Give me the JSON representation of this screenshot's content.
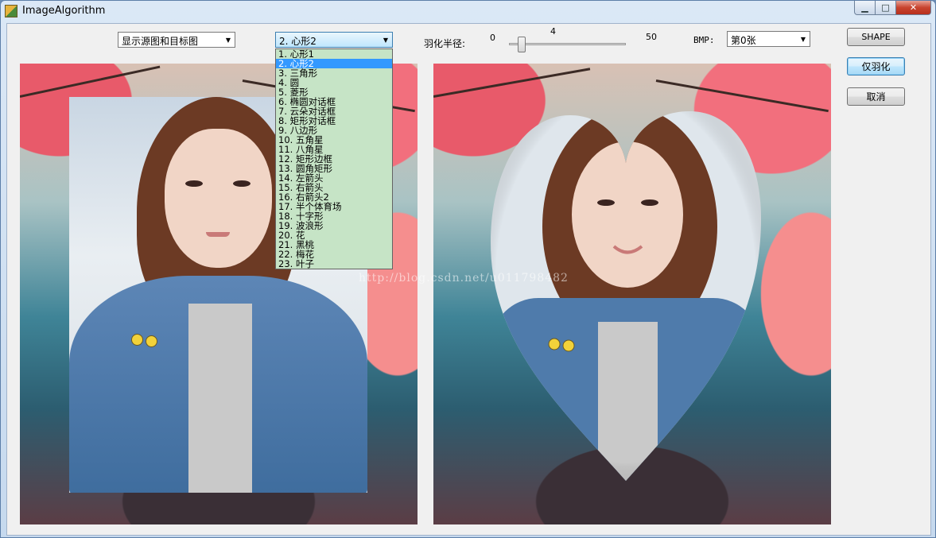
{
  "window": {
    "title": "ImageAlgorithm",
    "minimize": "▁",
    "maximize": "□",
    "close": "✕"
  },
  "toolbar": {
    "display_mode": "显示源图和目标图",
    "shape_selected": "2. 心形2",
    "feather_label": "羽化半径:",
    "slider": {
      "min": "0",
      "value": "4",
      "max": "50",
      "value_num": 4
    },
    "bmp_label": "BMP:",
    "bmp_selected": "第0张"
  },
  "buttons": {
    "shape": "SHAPE",
    "feather_only": "仅羽化",
    "cancel": "取消"
  },
  "shape_list": [
    "1. 心形1",
    "2. 心形2",
    "3. 三角形",
    "4. 圆",
    "5. 菱形",
    "6. 椭圆对话框",
    "7. 云朵对话框",
    "8. 矩形对话框",
    "9. 八边形",
    "10. 五角星",
    "11. 八角星",
    "12. 矩形边框",
    "13. 圆角矩形",
    "14. 左箭头",
    "15. 右箭头",
    "16. 右箭头2",
    "17. 半个体育场",
    "18. 十字形",
    "19. 波浪形",
    "20. 花",
    "21. 黑桃",
    "22. 梅花",
    "23. 叶子"
  ],
  "selected_index": 1,
  "watermark": "http://blog.csdn.net/u011798482",
  "colors": {
    "selection": "#3399ff",
    "dropdown_bg": "#c6e4c6"
  }
}
